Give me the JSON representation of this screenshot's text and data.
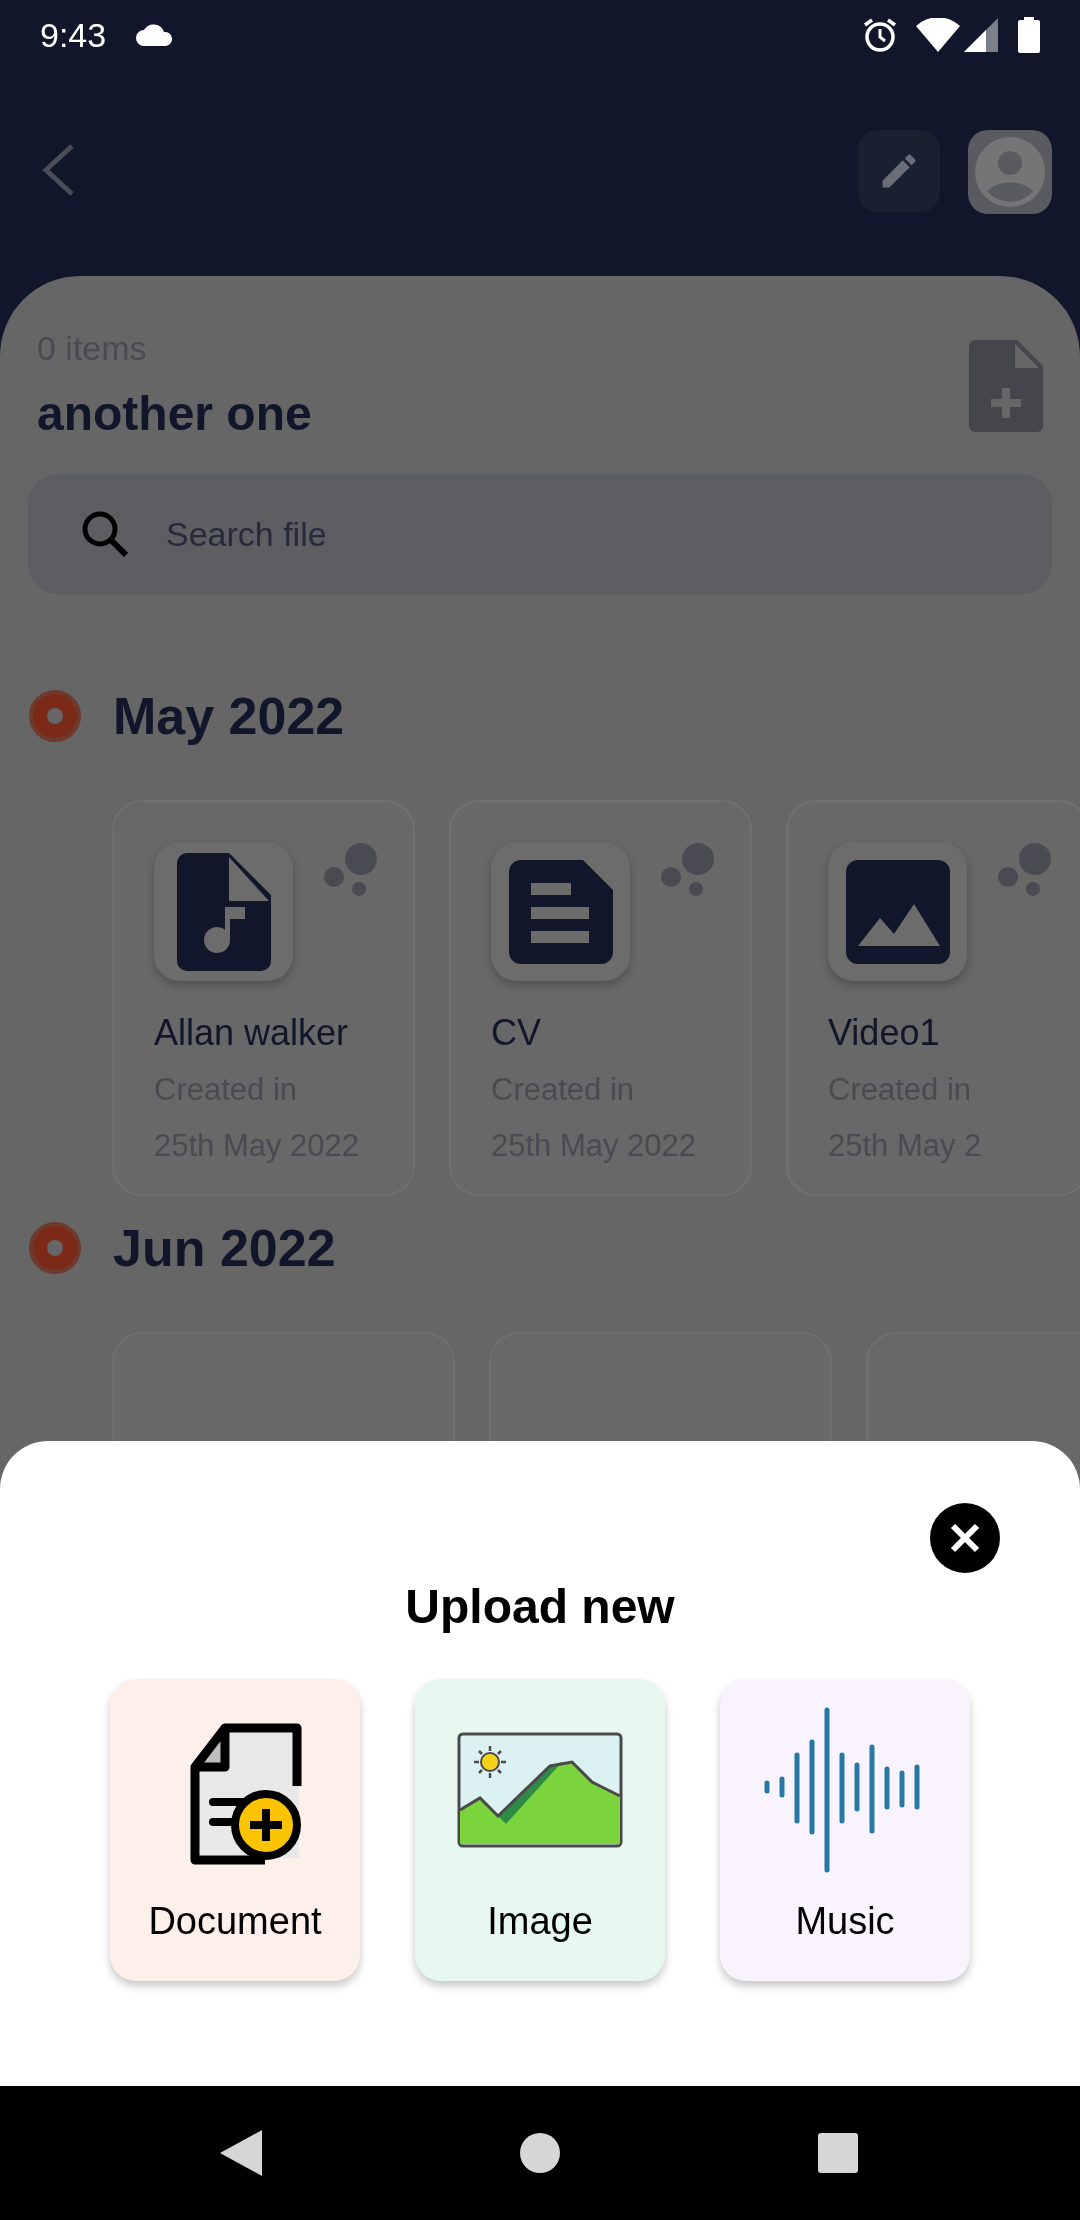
{
  "status_bar": {
    "time": "9:43"
  },
  "collection": {
    "count": "0 items",
    "title": "another one",
    "search": {
      "placeholder": "Search file"
    },
    "groups": [
      {
        "month": "May 2022",
        "files": [
          {
            "kind": "music",
            "name": "Allan walker",
            "created_label": "Created in",
            "date": "25th May 2022"
          },
          {
            "kind": "document",
            "name": "CV",
            "created_label": "Created in",
            "date": "25th May 2022"
          },
          {
            "kind": "image",
            "name": "Video1",
            "created_label": "Created in",
            "date": "25th May 2"
          }
        ]
      },
      {
        "month": "Jun 2022",
        "files": [
          {
            "kind": "hidden"
          },
          {
            "kind": "hidden"
          },
          {
            "kind": "hidden"
          }
        ]
      }
    ]
  },
  "upload_sheet": {
    "title": "Upload new",
    "options": [
      {
        "kind": "document",
        "label": "Document"
      },
      {
        "kind": "image",
        "label": "Image"
      },
      {
        "kind": "music",
        "label": "Music"
      }
    ]
  }
}
